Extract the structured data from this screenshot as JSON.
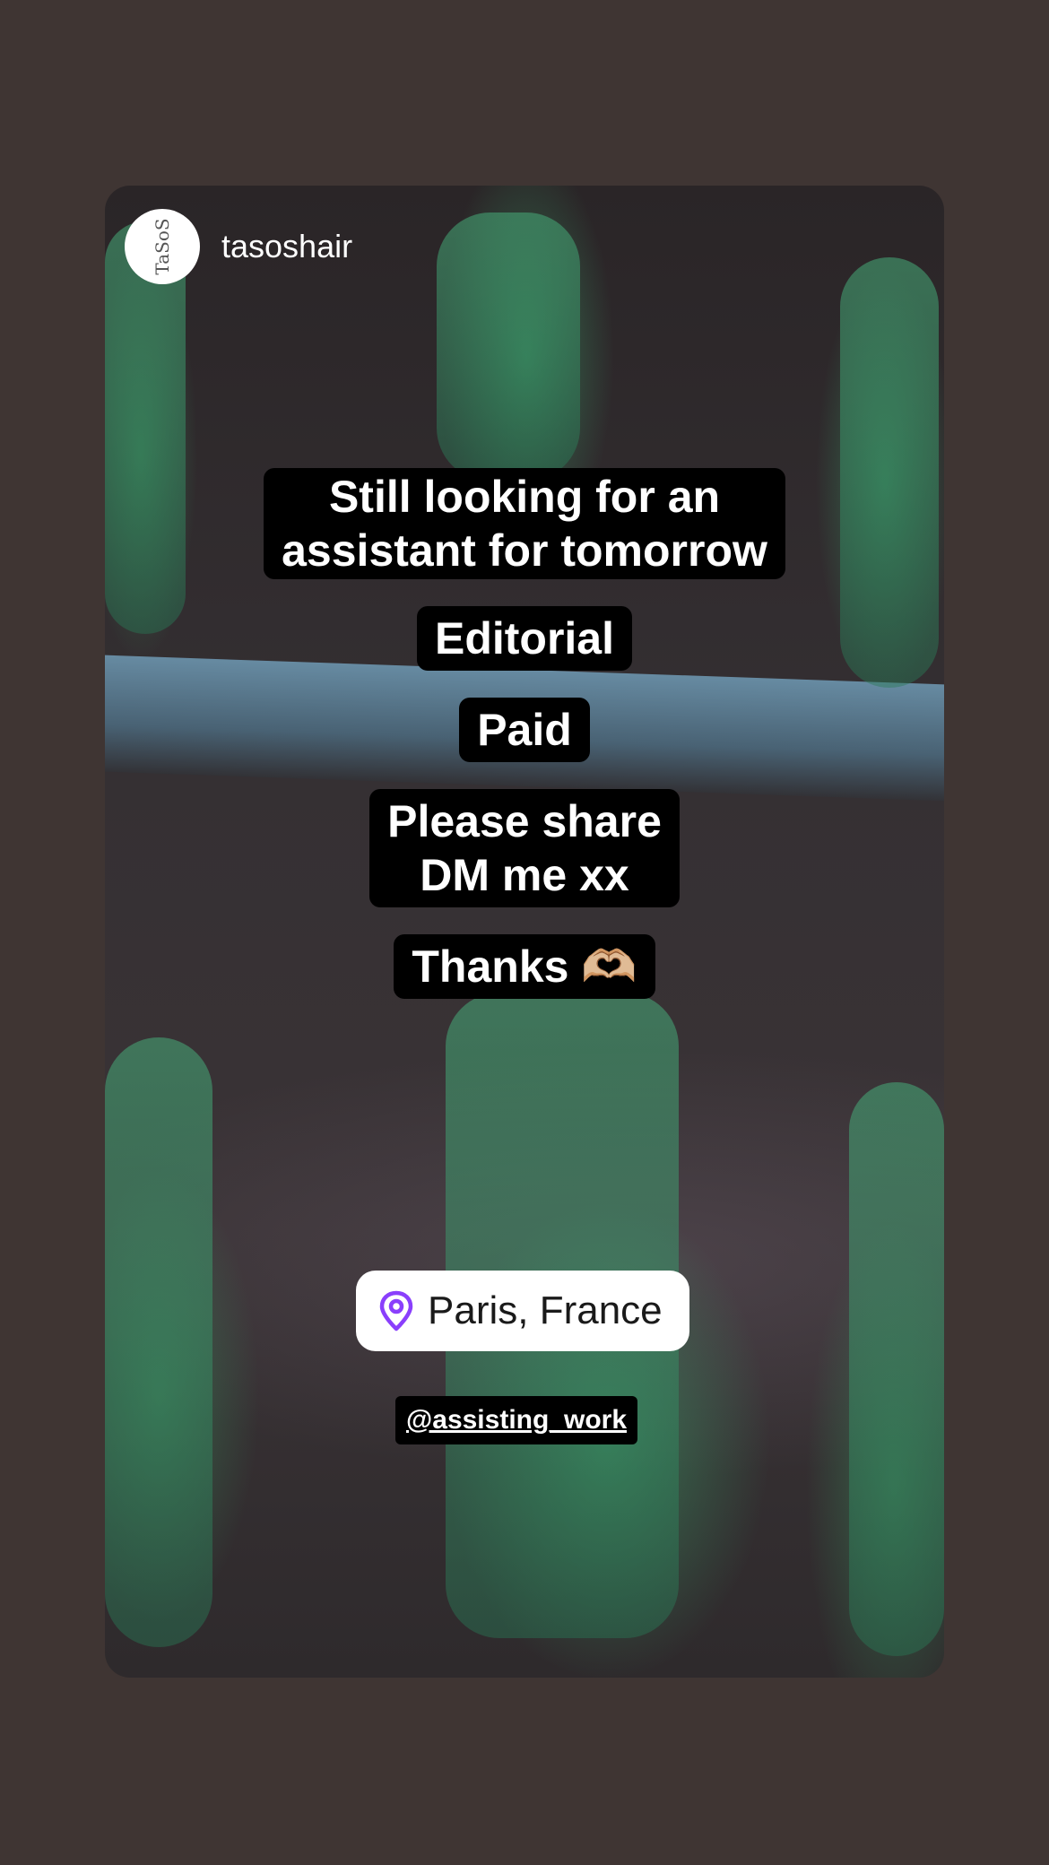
{
  "header": {
    "username": "tasoshair",
    "avatar_text": "TaSoS"
  },
  "captions": [
    "Still looking for an\nassistant for tomorrow",
    "Editorial",
    "Paid",
    "Please share\nDM me xx",
    "Thanks 🫶🏼"
  ],
  "location": {
    "label": "Paris, France",
    "icon": "location-pin-icon",
    "icon_color": "#8a3ffc"
  },
  "mention": {
    "label": "@assisting_work"
  },
  "colors": {
    "background": "#3f3533",
    "caption_bg": "#000000",
    "caption_text": "#ffffff"
  }
}
